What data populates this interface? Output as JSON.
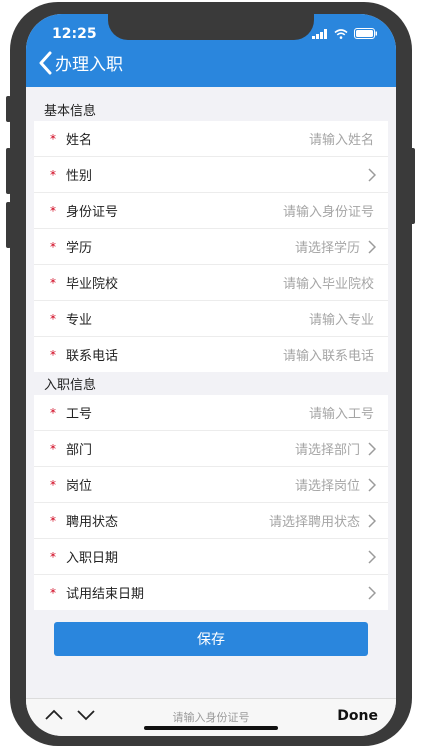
{
  "status_bar": {
    "time": "12:25"
  },
  "header": {
    "title": "办理入职"
  },
  "sections": [
    {
      "title": "基本信息",
      "rows": [
        {
          "label": "姓名",
          "placeholder": "请输入姓名",
          "arrow": false
        },
        {
          "label": "性别",
          "placeholder": "",
          "arrow": true
        },
        {
          "label": "身份证号",
          "placeholder": "请输入身份证号",
          "arrow": false
        },
        {
          "label": "学历",
          "placeholder": "请选择学历",
          "arrow": true
        },
        {
          "label": "毕业院校",
          "placeholder": "请输入毕业院校",
          "arrow": false
        },
        {
          "label": "专业",
          "placeholder": "请输入专业",
          "arrow": false
        },
        {
          "label": "联系电话",
          "placeholder": "请输入联系电话",
          "arrow": false
        }
      ]
    },
    {
      "title": "入职信息",
      "rows": [
        {
          "label": "工号",
          "placeholder": "请输入工号",
          "arrow": false
        },
        {
          "label": "部门",
          "placeholder": "请选择部门",
          "arrow": true
        },
        {
          "label": "岗位",
          "placeholder": "请选择岗位",
          "arrow": true
        },
        {
          "label": "聘用状态",
          "placeholder": "请选择聘用状态",
          "arrow": true
        },
        {
          "label": "入职日期",
          "placeholder": "",
          "arrow": true
        },
        {
          "label": "试用结束日期",
          "placeholder": "",
          "arrow": true
        }
      ]
    }
  ],
  "required_mark": "*",
  "save_button": "保存",
  "keyboard_toolbar": {
    "hint": "请输入身份证号",
    "done": "Done"
  },
  "colors": {
    "accent": "#2a86dd",
    "required": "#d0021b",
    "placeholder": "#a5a5a5"
  }
}
